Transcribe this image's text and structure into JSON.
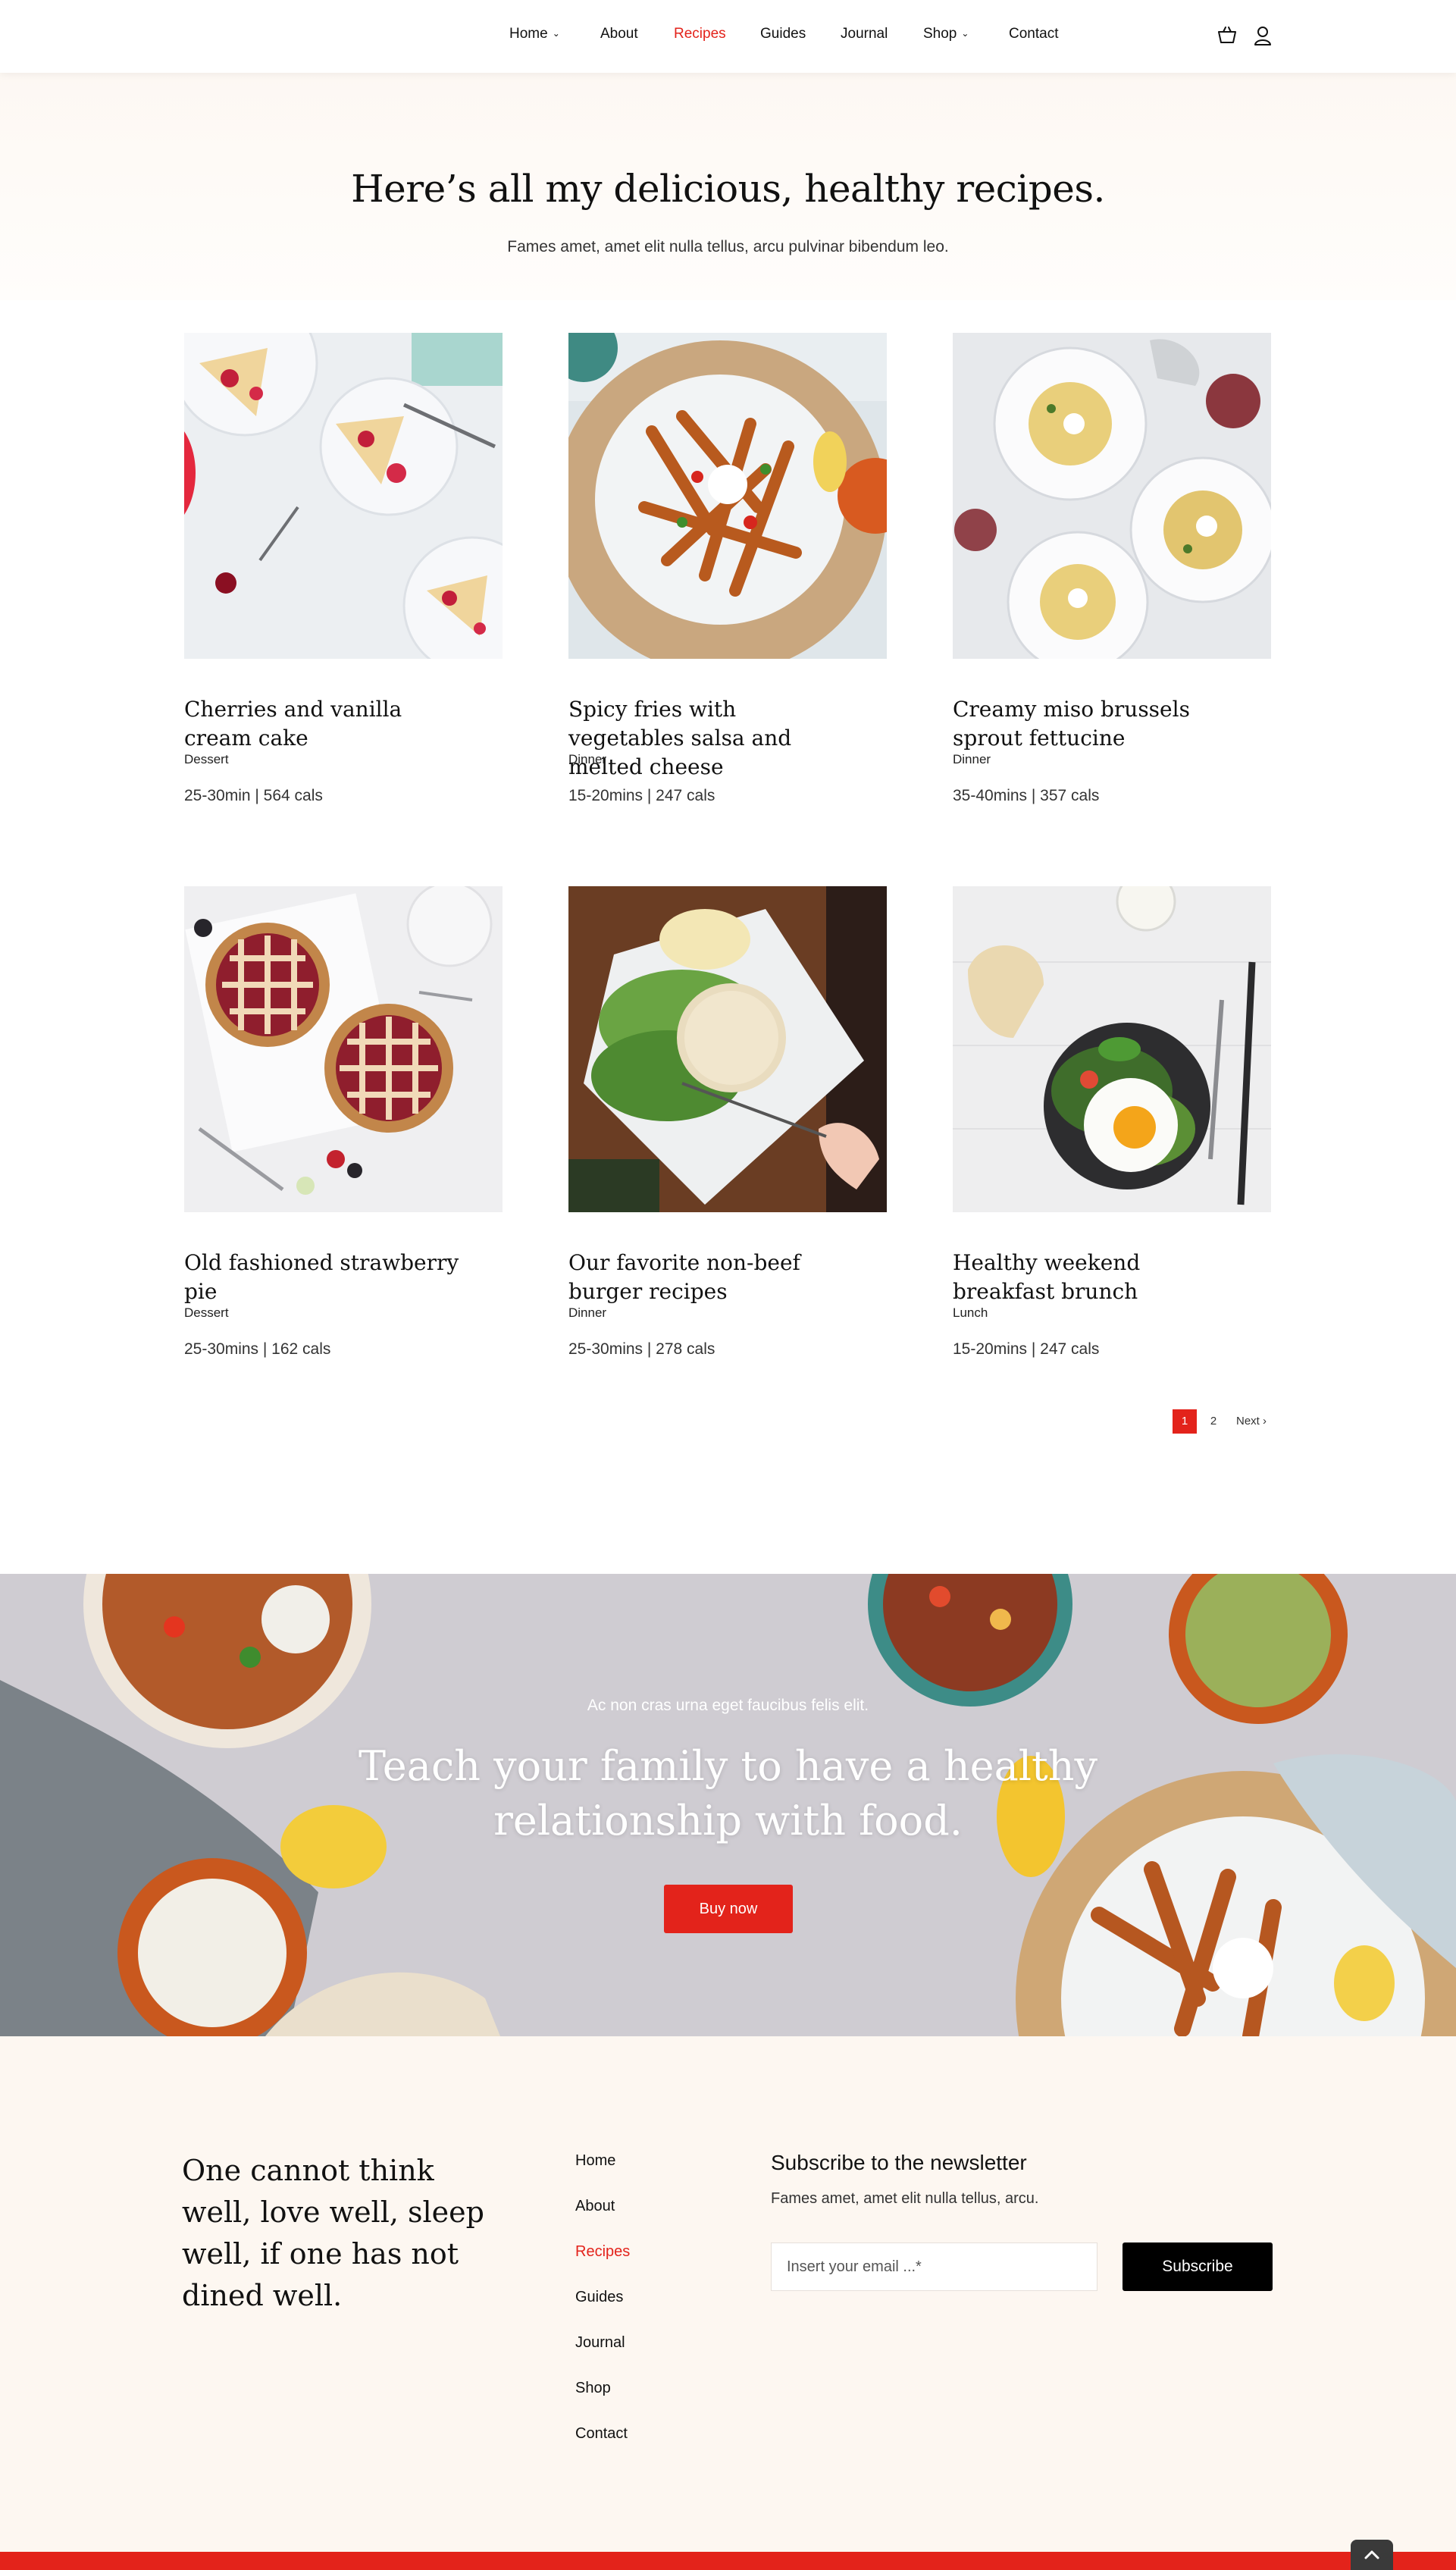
{
  "header": {
    "nav": [
      {
        "label": "Home",
        "has_dropdown": true,
        "active": false
      },
      {
        "label": "About",
        "has_dropdown": false,
        "active": false
      },
      {
        "label": "Recipes",
        "has_dropdown": false,
        "active": true
      },
      {
        "label": "Guides",
        "has_dropdown": false,
        "active": false
      },
      {
        "label": "Journal",
        "has_dropdown": false,
        "active": false
      },
      {
        "label": "Shop",
        "has_dropdown": true,
        "active": false
      },
      {
        "label": "Contact",
        "has_dropdown": false,
        "active": false
      }
    ],
    "icons": [
      "cart-icon",
      "user-icon"
    ]
  },
  "intro": {
    "title": "Here’s all my delicious, healthy recipes.",
    "subtitle": "Fames amet, amet elit nulla tellus, arcu pulvinar bibendum leo."
  },
  "recipes": [
    {
      "title": "Cherries and vanilla cream cake",
      "category": "Dessert",
      "meta": "25-30min | 564 cals"
    },
    {
      "title": "Spicy fries with vegetables salsa and melted cheese",
      "category": "Dinner",
      "meta": "15-20mins | 247 cals"
    },
    {
      "title": "Creamy miso brussels sprout fettucine",
      "category": "Dinner",
      "meta": "35-40mins | 357 cals"
    },
    {
      "title": "Old fashioned strawberry pie",
      "category": "Dessert",
      "meta": "25-30mins | 162 cals"
    },
    {
      "title": "Our favorite non-beef burger recipes",
      "category": "Dinner",
      "meta": "25-30mins | 278 cals"
    },
    {
      "title": "Healthy weekend breakfast brunch",
      "category": "Lunch",
      "meta": "15-20mins | 247 cals"
    }
  ],
  "pagination": {
    "current": "1",
    "page2": "2",
    "next": "Next"
  },
  "banner": {
    "kicker": "Ac non cras urna eget faucibus felis elit.",
    "title": "Teach your family to have a healthy relationship with food.",
    "button": "Buy now"
  },
  "footer": {
    "quote": "One cannot think well, love well, sleep well, if one has not dined well.",
    "links": [
      "Home",
      "About",
      "Recipes",
      "Guides",
      "Journal",
      "Shop",
      "Contact"
    ],
    "active_link": "Recipes",
    "newsletter": {
      "title": "Subscribe to the newsletter",
      "subtitle": "Fames amet, amet elit nulla tellus, arcu.",
      "placeholder": "Insert your email ...*",
      "button": "Subscribe"
    }
  },
  "colors": {
    "accent": "#e3231b",
    "footer_bg": "#fdf7f1",
    "banner_bg": "#cfccd3"
  }
}
